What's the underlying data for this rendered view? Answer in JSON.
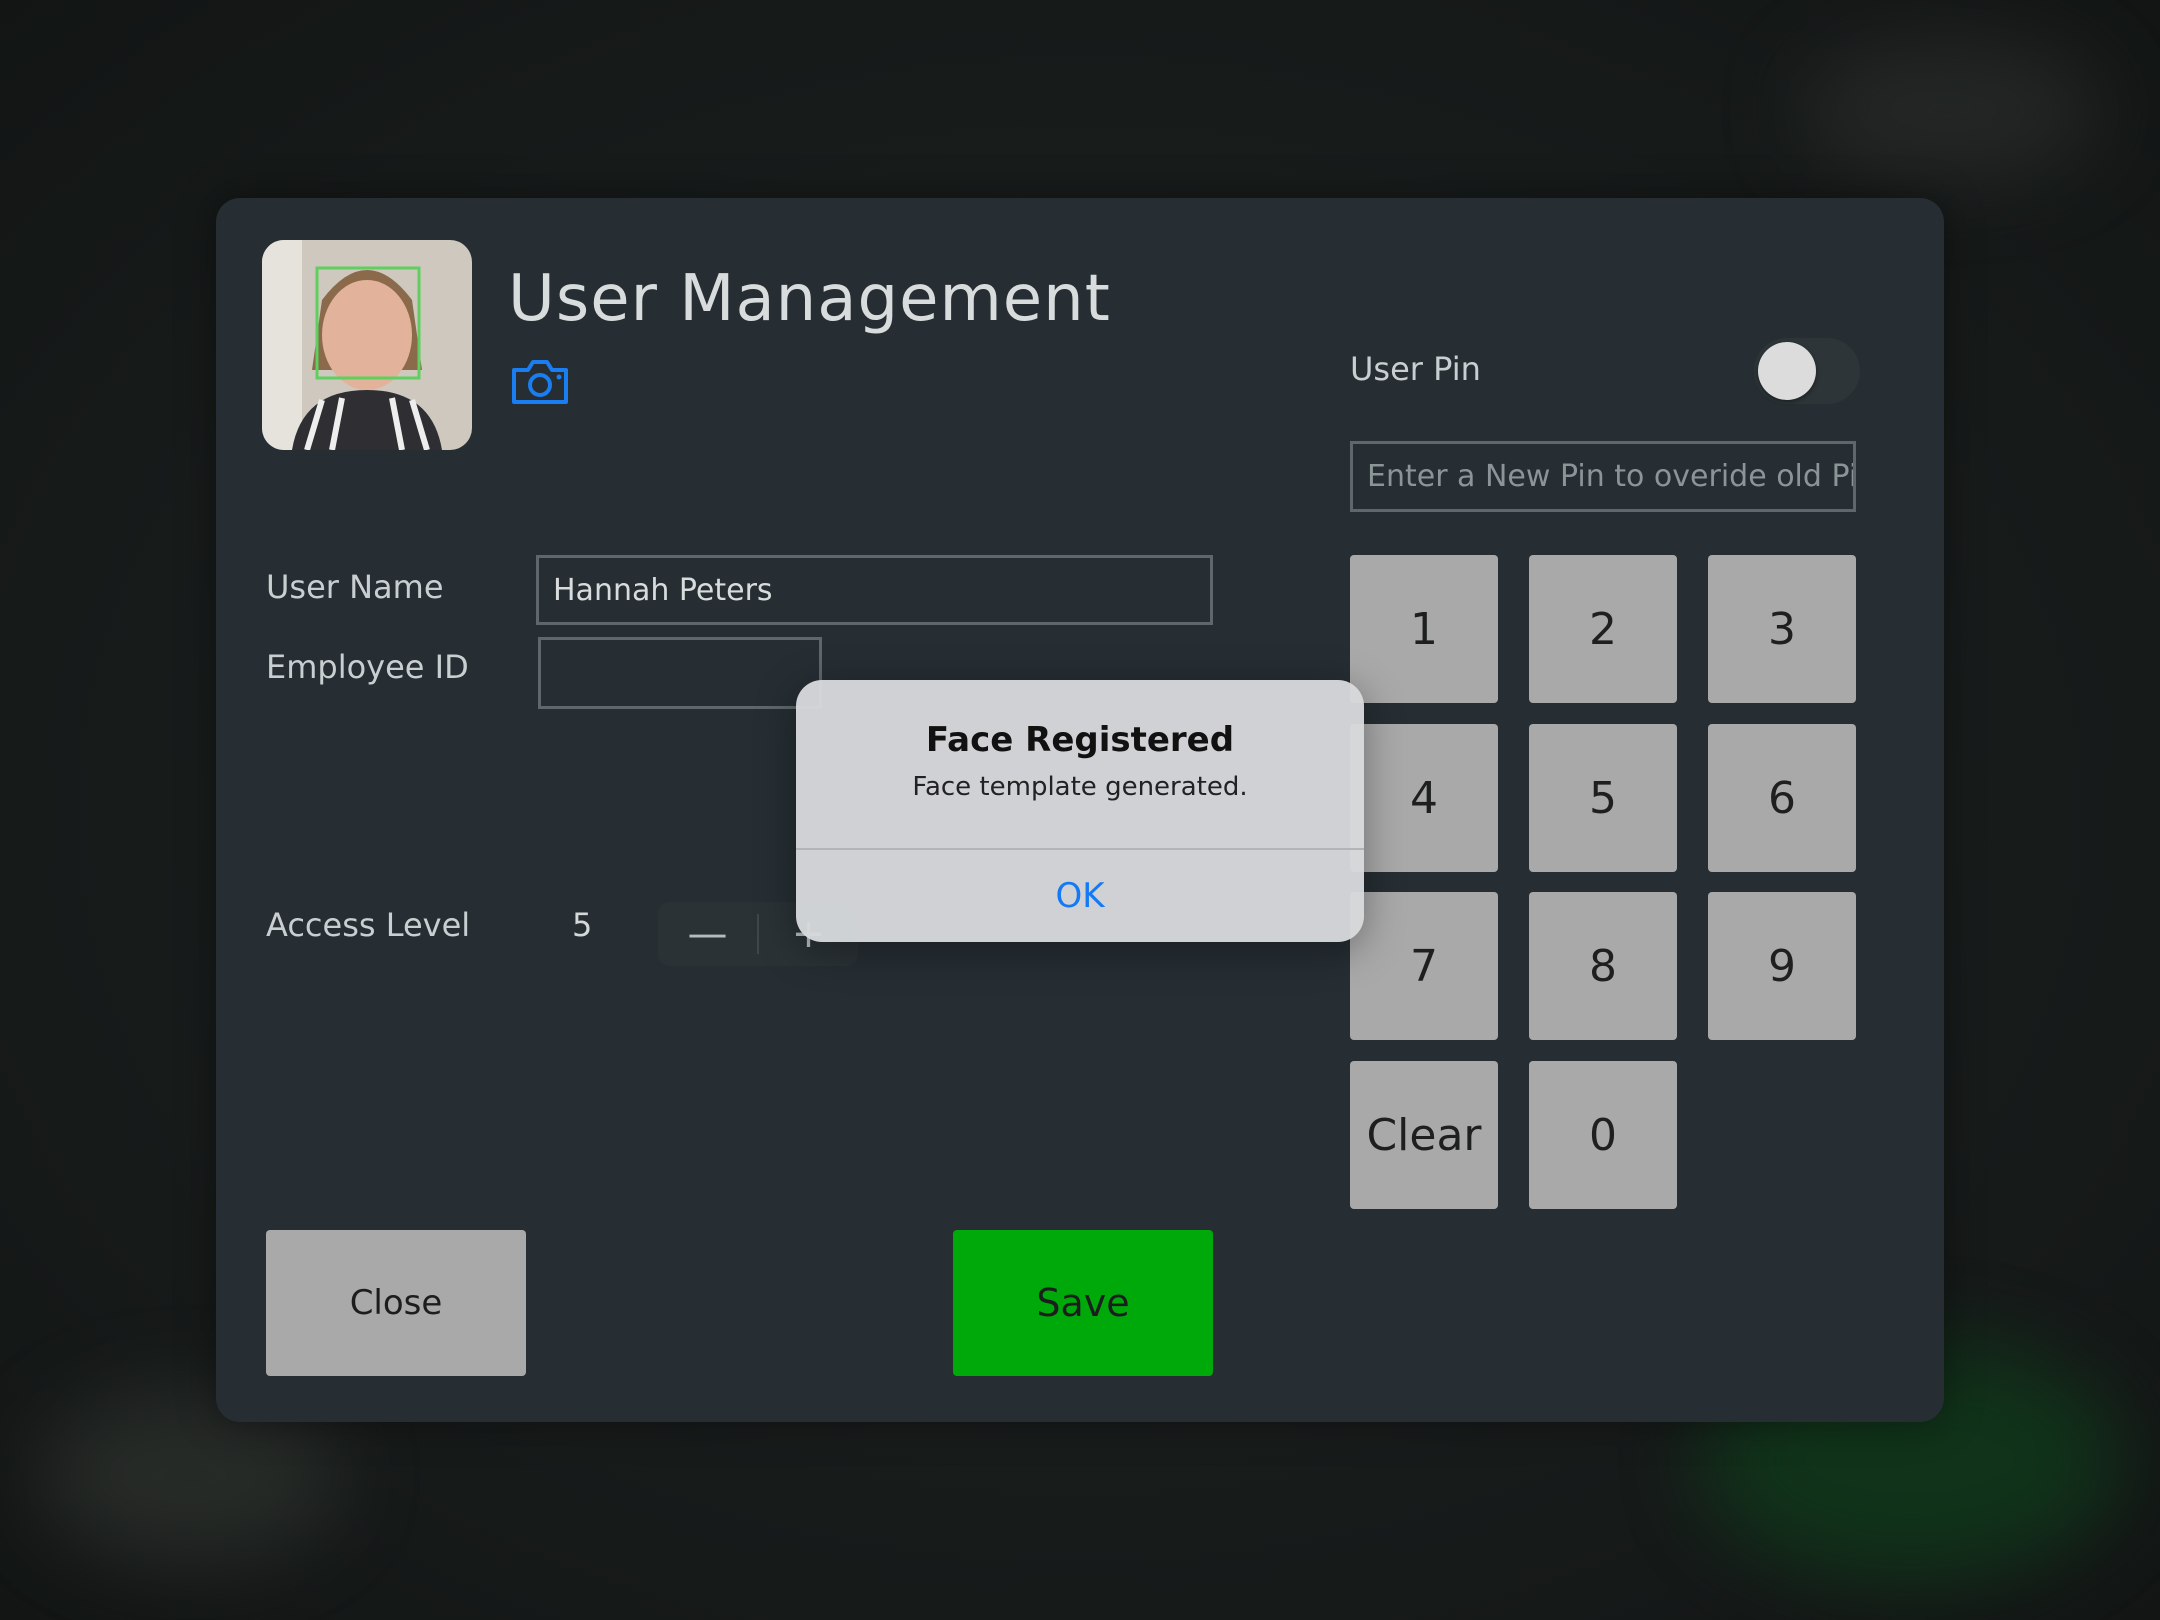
{
  "header": {
    "title": "User Management",
    "camera_icon": "camera-icon",
    "photo_icon": "user-face-photo"
  },
  "form": {
    "user_name_label": "User Name",
    "user_name_value": "Hannah Peters",
    "employee_id_label": "Employee ID",
    "employee_id_value": "",
    "access_level_label": "Access Level",
    "access_level_value": "5",
    "stepper_minus": "—",
    "stepper_plus": "+"
  },
  "pin": {
    "label": "User Pin",
    "toggle_on": false,
    "placeholder": "Enter a New Pin to overide old Pin",
    "keys": [
      "1",
      "2",
      "3",
      "4",
      "5",
      "6",
      "7",
      "8",
      "9",
      "Clear",
      "0"
    ]
  },
  "buttons": {
    "close": "Close",
    "save": "Save"
  },
  "alert": {
    "title": "Face Registered",
    "message": "Face template generated.",
    "ok": "OK"
  },
  "colors": {
    "save": "#00a90a",
    "accent": "#1479f5",
    "panel": "#262e33"
  }
}
